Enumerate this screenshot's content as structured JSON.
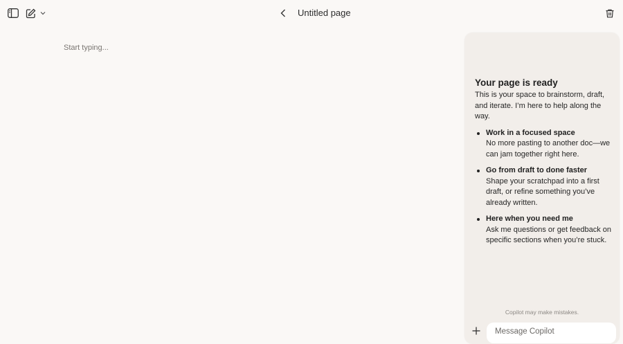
{
  "header": {
    "title": "Untitled page",
    "icons": {
      "sidebar_toggle": "sidebar-icon",
      "new_page": "new-page-icon",
      "new_page_dropdown": "chevron-down-icon",
      "back": "chevron-left-icon",
      "delete": "trash-icon"
    }
  },
  "editor": {
    "placeholder": "Start typing..."
  },
  "copilot": {
    "heading": "Your page is ready",
    "intro": "This is your space to brainstorm, draft, and iterate. I’m here to help along the way.",
    "features": [
      {
        "title": "Work in a focused space",
        "desc": "No more pasting to another doc—we can jam together right here."
      },
      {
        "title": "Go from draft to done faster",
        "desc": "Shape your scratchpad into a first draft, or refine something you’ve already written."
      },
      {
        "title": "Here when you need me",
        "desc": "Ask me questions or get feedback on specific sections when you’re stuck."
      }
    ],
    "disclaimer": "Copilot may make mistakes.",
    "composer": {
      "placeholder": "Message Copilot",
      "add_icon": "plus-icon"
    }
  },
  "colors": {
    "background": "#faf8f6",
    "panel": "#f2eeea",
    "text": "#222222"
  }
}
